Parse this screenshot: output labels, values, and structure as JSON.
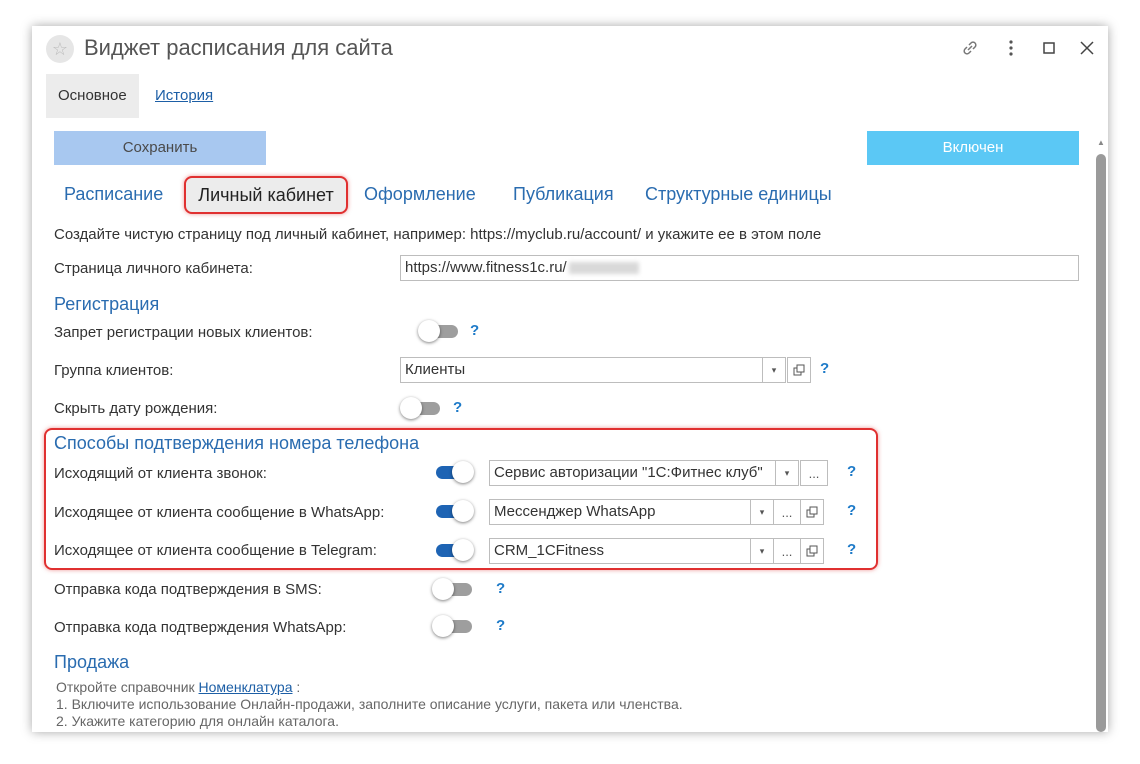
{
  "window": {
    "title": "Виджет расписания для сайта",
    "controls": [
      "link-icon",
      "more-icon",
      "maximize-icon",
      "close-icon"
    ]
  },
  "tabs": {
    "main": "Основное",
    "history": "История"
  },
  "toolbar": {
    "save_label": "Сохранить",
    "enabled_label": "Включен"
  },
  "subtabs": [
    "Расписание",
    "Личный кабинет",
    "Оформление",
    "Публикация",
    "Структурные единицы"
  ],
  "active_subtab": "Личный кабинет",
  "intro_text": "Создайте чистую страницу под личный кабинет, например: https://myclub.ru/account/ и укажите ее в этом поле",
  "account_page": {
    "label": "Страница личного кабинета:",
    "value": "https://www.fitness1c.ru/"
  },
  "registration": {
    "title": "Регистрация",
    "ban_label": "Запрет регистрации новых клиентов:",
    "ban_on": false,
    "group_label": "Группа клиентов:",
    "group_value": "Клиенты",
    "hide_birth_label": "Скрыть дату рождения:",
    "hide_birth_on": false
  },
  "phone_confirm": {
    "title": "Способы подтверждения номера телефона",
    "call_label": "Исходящий от клиента звонок:",
    "call_value": "Сервис авторизации \"1С:Фитнес клуб\"",
    "whatsapp_label": "Исходящее от клиента сообщение в WhatsApp:",
    "whatsapp_value": "Мессенджер WhatsApp",
    "telegram_label": "Исходящее от клиента сообщение в Telegram:",
    "telegram_value": "CRM_1CFitness"
  },
  "sms_label": "Отправка кода подтверждения в SMS:",
  "wa_code_label": "Отправка кода подтверждения WhatsApp:",
  "sale": {
    "title": "Продажа",
    "line1_prefix": "Откройте справочник",
    "line1_link": "Номенклатура",
    "line1_suffix": ":",
    "line2": "1. Включите использование Онлайн-продажи, заполните описание услуги, пакета или членства.",
    "line3": "2. Укажите категорию для онлайн каталога."
  },
  "common": {
    "help": "?",
    "more": "...",
    "dropdown": "▾"
  },
  "colors": {
    "accent": "#2a6cb0",
    "toggle_on": "#1e64b4",
    "highlight": "#e03030",
    "enabled_btn": "#5bc8f5",
    "save_btn": "#a8c8f0"
  }
}
